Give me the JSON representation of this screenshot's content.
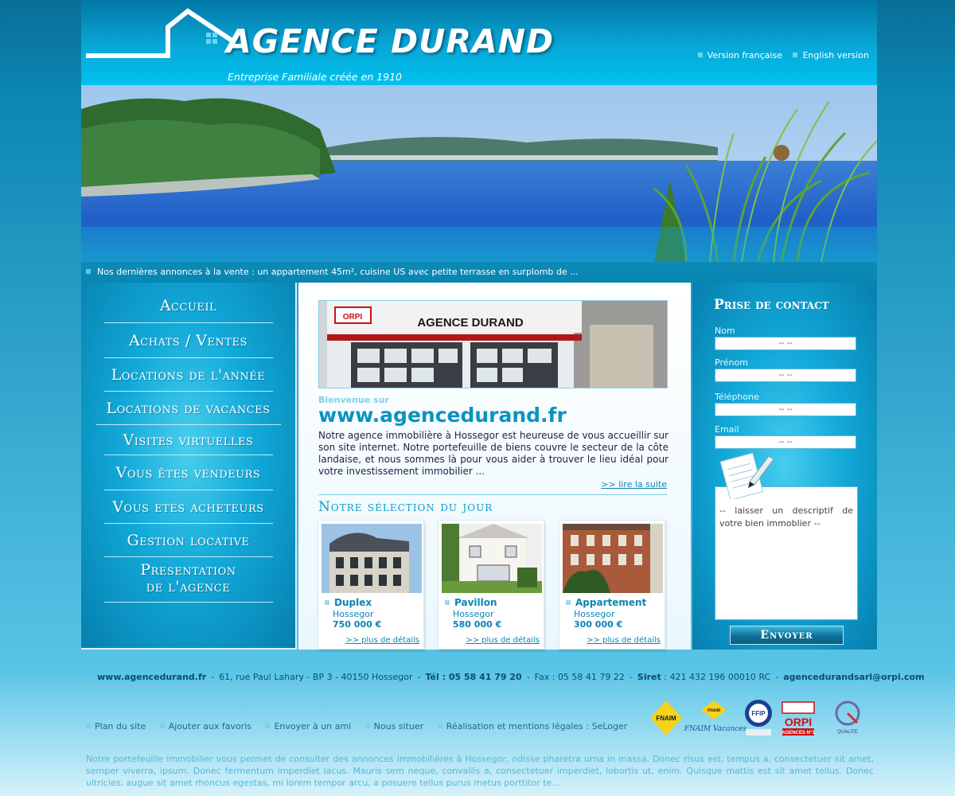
{
  "header": {
    "title": "AGENCE DURAND",
    "subtitle": "Entreprise Familiale créée en 1910",
    "languages": [
      "Version française",
      "English version"
    ]
  },
  "ticker": "Nos dernières annonces à la vente : un appartement 45m², cuisine US avec petite terrasse en surplomb de ...",
  "nav": {
    "items": [
      "Accueil",
      "Achats / Ventes",
      "Locations de l'année",
      "Locations de vacances",
      "Visites virtuelles",
      "Vous êtes vendeurs",
      "Vous etes acheteurs",
      "Gestion locative",
      "Presentation",
      "de l'agence"
    ]
  },
  "center": {
    "shop_sign": "AGENCE DURAND",
    "welcome_small": "Bienvenue sur",
    "welcome_site": "www.agencedurand.fr",
    "intro": "Notre agence immobilière à Hossegor est heureuse de vous accueillir sur son site internet. Notre portefeuille de biens couvre le secteur de la côte landaise, et nous sommes là pour vous aider à trouver le lieu idéal pour votre investissement immobilier ...",
    "read_more": ">> lire la suite",
    "selection_title": "Notre sélection du jour",
    "cards": [
      {
        "type": "Duplex",
        "city": "Hossegor",
        "price": "750 000 €",
        "more": ">> plus de détails"
      },
      {
        "type": "Pavillon",
        "city": "Hossegor",
        "price": "580 000 €",
        "more": ">> plus de détails"
      },
      {
        "type": "Appartement",
        "city": "Hossegor",
        "price": "300 000 €",
        "more": ">> plus de détails"
      }
    ]
  },
  "contact": {
    "title": "Prise de contact",
    "fields": [
      {
        "label": "Nom",
        "value": "-- --"
      },
      {
        "label": "Prénom",
        "value": "-- --"
      },
      {
        "label": "Téléphone",
        "value": "-- --"
      },
      {
        "label": "Email",
        "value": "-- --"
      }
    ],
    "message": "-- laisser un descriptif de votre bien immoblier --",
    "send": "Envoyer"
  },
  "footer": {
    "site": "www.agencedurand.fr",
    "address": "61, rue Paul Lahary - BP 3 - 40150 Hossegor",
    "tel_label": "Tél : 05 58 41 79 20",
    "fax": "Fax : 05 58 41 79 22",
    "siret_label": "Siret",
    "siret": ": 421 432 196 00010 RC",
    "email": "agencedurandsarl@orpi.com",
    "links": [
      "Plan du site",
      "Ajouter aux favoris",
      "Envoyer à un ami",
      "Nous situer",
      "Réalisation et mentions légales : SeLoger"
    ],
    "logos": [
      "FNAIM",
      "FNAIM Vacances",
      "FFIP",
      "ORPI",
      "AGENCES N°1",
      "QUALITE"
    ],
    "lorem": "Notre portefeuille immobilier vous permet de consulter des annonces immobilières à  Hossegor, ndisse pharetra urna in massa. Donec risus est, tempus a, consectetuer sit amet, semper viverra, ipsum. Donec fermentum imperdiet lacus. Mauris sem neque, convallis a, consectetuer imperdiet, lobortis ut, enim. Quisque mattis est sit amet tellus. Donec ultricies, augue sit amet rhoncus egestas, mi lorem tempor arcu, a posuere tellus purus metus porttitor te..."
  }
}
